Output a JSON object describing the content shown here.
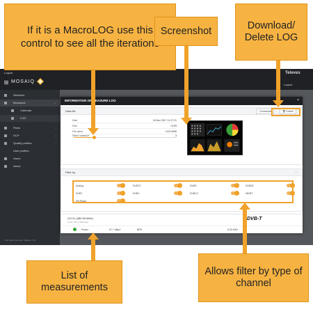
{
  "callouts": {
    "macrolog": "If it is a MacroLOG use this control to see all the iterations",
    "screenshot": "Screenshot",
    "download_delete": "Download/ Delete LOG",
    "list": "List of measurements",
    "filter": "Allows filter by type of channel"
  },
  "topbar": {
    "login": "Logout",
    "brand": "Televes",
    "logo": "MOSAIQ",
    "logout": "Logout"
  },
  "sidebar": {
    "items": [
      {
        "label": "Sessions"
      },
      {
        "label": "Measures"
      },
      {
        "label": "Calendar"
      },
      {
        "label": "LOG"
      },
      {
        "label": "Plans"
      },
      {
        "label": "GCP"
      },
      {
        "label": "Quality profiles"
      },
      {
        "label": "User profiles"
      },
      {
        "label": "Users"
      },
      {
        "label": "About"
      }
    ]
  },
  "footer": {
    "copyright": "© All rights reserved. Televés, S.A."
  },
  "modal": {
    "title": "INFORMATION OF MEASURE LOG",
    "close": "×",
    "data_file": {
      "title": "Data file",
      "download": "Download",
      "delete": "Delete",
      "rows": [
        {
          "key": "Date",
          "value": "16 Nov 2017 11:17:21"
        },
        {
          "key": "Plan",
          "value": "CCIR"
        },
        {
          "key": "File name",
          "value": "LOG-0006"
        },
        {
          "key": "Select measure",
          "value": "3"
        }
      ],
      "slider_fraction": 0.2
    },
    "filter": {
      "title": "Filter by",
      "collapse": "—",
      "options": [
        "Analog",
        "DVBT2",
        "DVBS",
        "DVBS2",
        "DVBT",
        "DVBC",
        "DVBC2",
        "ISDBT",
        "FM Radio"
      ]
    },
    "measurement": {
      "channel": "CH 21 (450.00 MHz)",
      "sub": "1 Item, 387 of 400 meas",
      "standard": "DVB-T",
      "row": [
        "Power",
        "57.7 dBµV",
        "BER",
        "8.00 MHz"
      ]
    }
  }
}
